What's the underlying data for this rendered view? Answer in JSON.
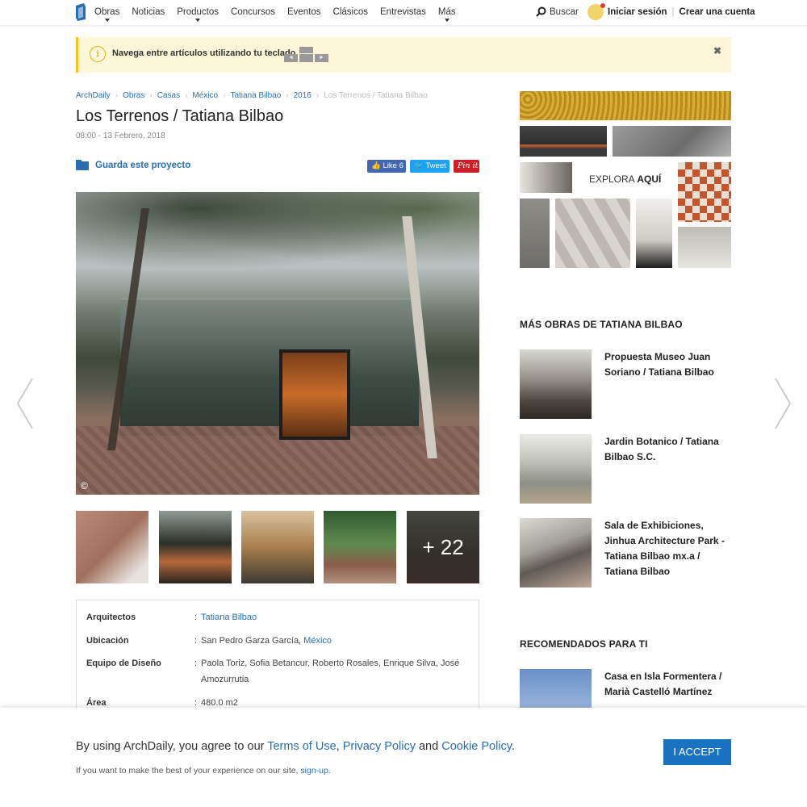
{
  "nav": {
    "items": [
      {
        "label": "Obras",
        "has_menu": true
      },
      {
        "label": "Noticias",
        "has_menu": false
      },
      {
        "label": "Productos",
        "has_menu": true
      },
      {
        "label": "Concursos",
        "has_menu": false
      },
      {
        "label": "Eventos",
        "has_menu": false
      },
      {
        "label": "Clásicos",
        "has_menu": false
      },
      {
        "label": "Entrevistas",
        "has_menu": false
      },
      {
        "label": "Más",
        "has_menu": true
      }
    ],
    "search_label": "Buscar",
    "login_label": "Iniciar sesión",
    "signup_label": "Crear una cuenta"
  },
  "notice": {
    "text": "Navega entre artículos utilizando tu teclado",
    "close": "✖"
  },
  "breadcrumb": [
    "ArchDaily",
    "Obras",
    "Casas",
    "México",
    "Tatiana Bilbao",
    "2016",
    "Los Terrenos / Tatiana Bilbao"
  ],
  "article": {
    "title": "Los Terrenos / Tatiana Bilbao",
    "date": "08:00 - 13 Febrero, 2018",
    "save_label": "Guarda este proyecto",
    "like_label": "Like",
    "like_count": "6",
    "tweet_label": "Tweet",
    "pin_label": "Pin it",
    "copyright": "©",
    "more_photos": "+ 22"
  },
  "specs": [
    {
      "label": "Arquitectos",
      "value": "",
      "link": "Tatiana Bilbao"
    },
    {
      "label": "Ubicación",
      "value": "San Pedro Garza García, ",
      "link": "México"
    },
    {
      "label": "Equipo de Diseño",
      "value": "Paola Toriz, Sofia Betancur, Roberto Rosales, Enrique Silva, José Amozurrutia",
      "link": ""
    },
    {
      "label": "Área",
      "value": "480.0 m2",
      "link": ""
    }
  ],
  "sidebar": {
    "ad_label_prefix": "EXPLORA ",
    "ad_label_bold": "AQUÍ",
    "more_works_heading": "MÁS OBRAS DE TATIANA BILBAO",
    "more_works": [
      "Propuesta Museo Juan Soriano / Tatiana Bilbao",
      "Jardin Botanico / Tatiana Bilbao S.C.",
      "Sala de Exhibiciones, Jinhua Architecture Park - Tatiana Bilbao mx.a / Tatiana Bilbao"
    ],
    "recommended_heading": "RECOMENDADOS PARA TI",
    "recommended": [
      "Casa en Isla Formentera / Marià Castelló Martínez"
    ]
  },
  "cookie": {
    "prefix": "By using ArchDaily, you agree to our ",
    "terms": "Terms of Use",
    "comma": ", ",
    "privacy": "Privacy Policy",
    "and": " and ",
    "cookie_policy": "Cookie Policy",
    "period": ".",
    "sub_prefix": "If you want to make the best of your experience on our site, ",
    "signup": "sign-up",
    "sub_suffix": ".",
    "accept": "I ACCEPT"
  },
  "colors": {
    "link": "#2a6fad",
    "notice_bg": "#fdf6d8",
    "accept_bg": "#1a73c1"
  }
}
